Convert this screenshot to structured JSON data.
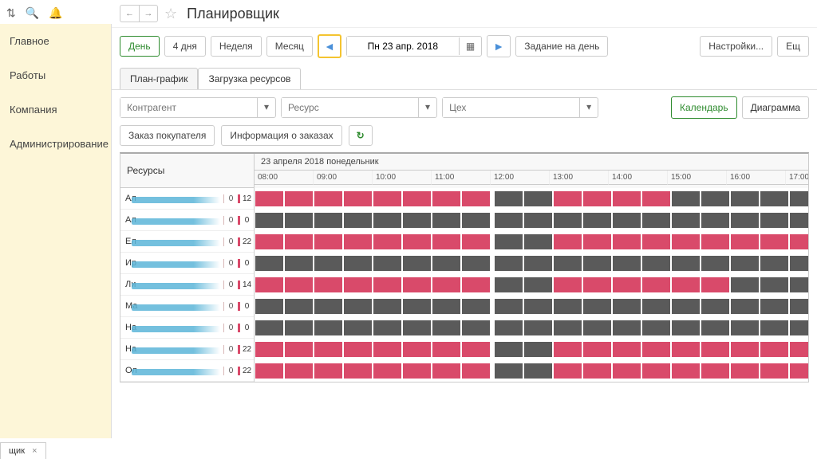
{
  "title": "Планировщик",
  "sidebar": {
    "items": [
      "Главное",
      "Работы",
      "Компания",
      "Администрирование"
    ]
  },
  "toolbar": {
    "day": "День",
    "days4": "4 дня",
    "week": "Неделя",
    "month": "Месяц",
    "date": "Пн 23 апр. 2018",
    "task": "Задание на день",
    "settings": "Настройки...",
    "more": "Ещ"
  },
  "tabs": {
    "plan": "План-график",
    "load": "Загрузка ресурсов"
  },
  "filters": {
    "contractor_ph": "Контрагент",
    "resource_ph": "Ресурс",
    "shop_ph": "Цех",
    "calendar": "Календарь",
    "diagram": "Диаграмма"
  },
  "actions": {
    "order": "Заказ покупателя",
    "info": "Информация о заказах"
  },
  "grid": {
    "res_header": "Ресурсы",
    "date_header": "23 апреля 2018 понедельник",
    "hours": [
      "08:00",
      "09:00",
      "10:00",
      "11:00",
      "12:00",
      "13:00",
      "14:00",
      "15:00",
      "16:00",
      "17:00"
    ],
    "rows": [
      {
        "name": "Ал",
        "c1": 0,
        "c2": 12,
        "pattern": "rrrrrrrr.ggrrrrgggggg"
      },
      {
        "name": "Ал",
        "c1": 0,
        "c2": 0,
        "pattern": "gggggggg.gggggggggggg"
      },
      {
        "name": "Ел",
        "c1": 0,
        "c2": 22,
        "pattern": "rrrrrrrr.ggrrrrrrrrrr"
      },
      {
        "name": "Ир",
        "c1": 0,
        "c2": 0,
        "pattern": "gggggggg.gggggggggggg"
      },
      {
        "name": "Ли",
        "c1": 0,
        "c2": 14,
        "pattern": "rrrrrrrr.ggrrrrrrgggg"
      },
      {
        "name": "Ма",
        "c1": 0,
        "c2": 0,
        "pattern": "gggggggg.gggggggggggg"
      },
      {
        "name": "На",
        "c1": 0,
        "c2": 0,
        "pattern": "gggggggg.gggggggggggg"
      },
      {
        "name": "На",
        "c1": 0,
        "c2": 22,
        "pattern": "rrrrrrrr.ggrrrrrrrrrr"
      },
      {
        "name": "Ол",
        "c1": 0,
        "c2": 22,
        "pattern": "rrrrrrrr.ggrrrrrrrrrr"
      }
    ]
  },
  "bottom_tab": "щик"
}
